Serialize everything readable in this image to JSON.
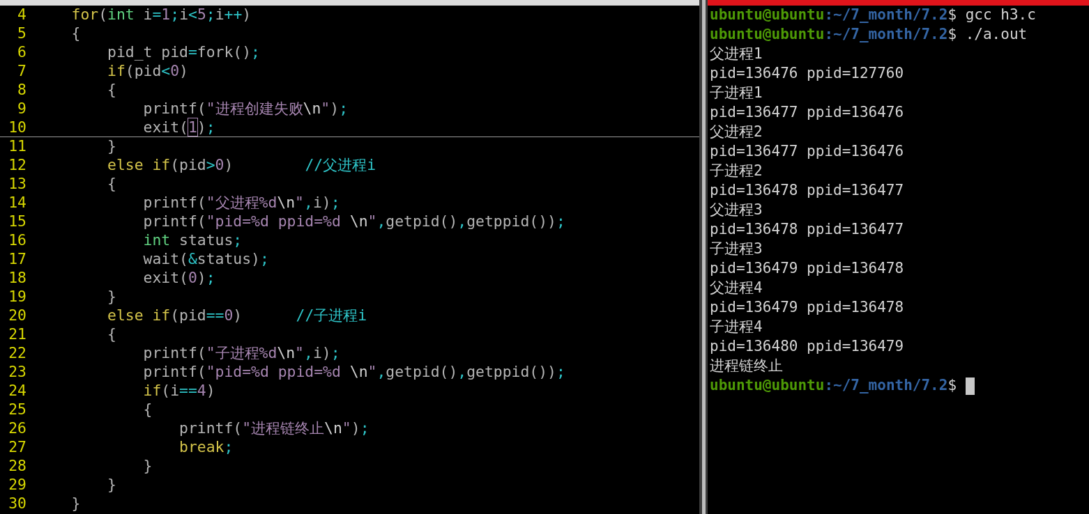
{
  "editor": {
    "lines": [
      {
        "number": "4",
        "tokens": [
          {
            "t": "    for",
            "kind": "kw"
          },
          {
            "t": "(",
            "kind": "plain"
          },
          {
            "t": "int",
            "kind": "type"
          },
          {
            "t": " i",
            "kind": "plain"
          },
          {
            "t": "=",
            "kind": "op"
          },
          {
            "t": "1",
            "kind": "num"
          },
          {
            "t": ";",
            "kind": "op"
          },
          {
            "t": "i",
            "kind": "plain"
          },
          {
            "t": "<",
            "kind": "op"
          },
          {
            "t": "5",
            "kind": "num"
          },
          {
            "t": ";",
            "kind": "op"
          },
          {
            "t": "i",
            "kind": "plain"
          },
          {
            "t": "++",
            "kind": "op"
          },
          {
            "t": ")",
            "kind": "plain"
          }
        ]
      },
      {
        "number": "5",
        "tokens": [
          {
            "t": "    {",
            "kind": "plain"
          }
        ]
      },
      {
        "number": "6",
        "tokens": [
          {
            "t": "        pid_t pid",
            "kind": "plain"
          },
          {
            "t": "=",
            "kind": "op"
          },
          {
            "t": "fork()",
            "kind": "plain"
          },
          {
            "t": ";",
            "kind": "op"
          }
        ]
      },
      {
        "number": "7",
        "tokens": [
          {
            "t": "        if",
            "kind": "kw"
          },
          {
            "t": "(pid",
            "kind": "plain"
          },
          {
            "t": "<",
            "kind": "op"
          },
          {
            "t": "0",
            "kind": "num"
          },
          {
            "t": ")",
            "kind": "plain"
          }
        ]
      },
      {
        "number": "8",
        "tokens": [
          {
            "t": "        {",
            "kind": "plain"
          }
        ]
      },
      {
        "number": "9",
        "tokens": [
          {
            "t": "            printf(",
            "kind": "plain"
          },
          {
            "t": "\"进程创建失败",
            "kind": "str"
          },
          {
            "t": "\\n",
            "kind": "esc"
          },
          {
            "t": "\"",
            "kind": "str"
          },
          {
            "t": ")",
            "kind": "plain"
          },
          {
            "t": ";",
            "kind": "op"
          }
        ]
      },
      {
        "number": "10",
        "current": true,
        "tokens": [
          {
            "t": "            exit(",
            "kind": "plain"
          },
          {
            "t": "1",
            "kind": "num",
            "cursor": true
          },
          {
            "t": ")",
            "kind": "plain"
          },
          {
            "t": ";",
            "kind": "op"
          }
        ]
      },
      {
        "number": "11",
        "tokens": [
          {
            "t": "        }",
            "kind": "plain"
          }
        ]
      },
      {
        "number": "12",
        "tokens": [
          {
            "t": "        else if",
            "kind": "kw"
          },
          {
            "t": "(pid",
            "kind": "plain"
          },
          {
            "t": ">",
            "kind": "op"
          },
          {
            "t": "0",
            "kind": "num"
          },
          {
            "t": ")        ",
            "kind": "plain"
          },
          {
            "t": "//父进程i",
            "kind": "cmt"
          }
        ]
      },
      {
        "number": "13",
        "tokens": [
          {
            "t": "        {",
            "kind": "plain"
          }
        ]
      },
      {
        "number": "14",
        "tokens": [
          {
            "t": "            printf(",
            "kind": "plain"
          },
          {
            "t": "\"父进程%d",
            "kind": "str"
          },
          {
            "t": "\\n",
            "kind": "esc"
          },
          {
            "t": "\"",
            "kind": "str"
          },
          {
            "t": ",",
            "kind": "op"
          },
          {
            "t": "i)",
            "kind": "plain"
          },
          {
            "t": ";",
            "kind": "op"
          }
        ]
      },
      {
        "number": "15",
        "tokens": [
          {
            "t": "            printf(",
            "kind": "plain"
          },
          {
            "t": "\"pid=%d ppid=%d ",
            "kind": "str"
          },
          {
            "t": "\\n",
            "kind": "esc"
          },
          {
            "t": "\"",
            "kind": "str"
          },
          {
            "t": ",",
            "kind": "op"
          },
          {
            "t": "getpid()",
            "kind": "plain"
          },
          {
            "t": ",",
            "kind": "op"
          },
          {
            "t": "getppid())",
            "kind": "plain"
          },
          {
            "t": ";",
            "kind": "op"
          }
        ]
      },
      {
        "number": "16",
        "tokens": [
          {
            "t": "            int",
            "kind": "type"
          },
          {
            "t": " status",
            "kind": "plain"
          },
          {
            "t": ";",
            "kind": "op"
          }
        ]
      },
      {
        "number": "17",
        "tokens": [
          {
            "t": "            wait(",
            "kind": "plain"
          },
          {
            "t": "&",
            "kind": "op"
          },
          {
            "t": "status)",
            "kind": "plain"
          },
          {
            "t": ";",
            "kind": "op"
          }
        ]
      },
      {
        "number": "18",
        "tokens": [
          {
            "t": "            exit(",
            "kind": "plain"
          },
          {
            "t": "0",
            "kind": "num"
          },
          {
            "t": ")",
            "kind": "plain"
          },
          {
            "t": ";",
            "kind": "op"
          }
        ]
      },
      {
        "number": "19",
        "tokens": [
          {
            "t": "        }",
            "kind": "plain"
          }
        ]
      },
      {
        "number": "20",
        "tokens": [
          {
            "t": "        else if",
            "kind": "kw"
          },
          {
            "t": "(pid",
            "kind": "plain"
          },
          {
            "t": "==",
            "kind": "op"
          },
          {
            "t": "0",
            "kind": "num"
          },
          {
            "t": ")      ",
            "kind": "plain"
          },
          {
            "t": "//子进程i",
            "kind": "cmt"
          }
        ]
      },
      {
        "number": "21",
        "tokens": [
          {
            "t": "        {",
            "kind": "plain"
          }
        ]
      },
      {
        "number": "22",
        "tokens": [
          {
            "t": "            printf(",
            "kind": "plain"
          },
          {
            "t": "\"子进程%d",
            "kind": "str"
          },
          {
            "t": "\\n",
            "kind": "esc"
          },
          {
            "t": "\"",
            "kind": "str"
          },
          {
            "t": ",",
            "kind": "op"
          },
          {
            "t": "i)",
            "kind": "plain"
          },
          {
            "t": ";",
            "kind": "op"
          }
        ]
      },
      {
        "number": "23",
        "tokens": [
          {
            "t": "            printf(",
            "kind": "plain"
          },
          {
            "t": "\"pid=%d ppid=%d ",
            "kind": "str"
          },
          {
            "t": "\\n",
            "kind": "esc"
          },
          {
            "t": "\"",
            "kind": "str"
          },
          {
            "t": ",",
            "kind": "op"
          },
          {
            "t": "getpid()",
            "kind": "plain"
          },
          {
            "t": ",",
            "kind": "op"
          },
          {
            "t": "getppid())",
            "kind": "plain"
          },
          {
            "t": ";",
            "kind": "op"
          }
        ]
      },
      {
        "number": "24",
        "tokens": [
          {
            "t": "            if",
            "kind": "kw"
          },
          {
            "t": "(i",
            "kind": "plain"
          },
          {
            "t": "==",
            "kind": "op"
          },
          {
            "t": "4",
            "kind": "num"
          },
          {
            "t": ")",
            "kind": "plain"
          }
        ]
      },
      {
        "number": "25",
        "tokens": [
          {
            "t": "            {",
            "kind": "plain"
          }
        ]
      },
      {
        "number": "26",
        "tokens": [
          {
            "t": "                printf(",
            "kind": "plain"
          },
          {
            "t": "\"进程链终止",
            "kind": "str"
          },
          {
            "t": "\\n",
            "kind": "esc"
          },
          {
            "t": "\"",
            "kind": "str"
          },
          {
            "t": ")",
            "kind": "plain"
          },
          {
            "t": ";",
            "kind": "op"
          }
        ]
      },
      {
        "number": "27",
        "tokens": [
          {
            "t": "                break",
            "kind": "kw"
          },
          {
            "t": ";",
            "kind": "op"
          }
        ]
      },
      {
        "number": "28",
        "tokens": [
          {
            "t": "            }",
            "kind": "plain"
          }
        ]
      },
      {
        "number": "29",
        "tokens": [
          {
            "t": "        }",
            "kind": "plain"
          }
        ]
      },
      {
        "number": "30",
        "tokens": [
          {
            "t": "    }",
            "kind": "plain"
          }
        ]
      }
    ]
  },
  "terminal": {
    "lines": [
      {
        "kind": "prompt",
        "user": "ubuntu@ubuntu",
        "path": ":~/7_month/7.2",
        "command": "$ gcc h3.c"
      },
      {
        "kind": "prompt",
        "user": "ubuntu@ubuntu",
        "path": ":~/7_month/7.2",
        "command": "$ ./a.out"
      },
      {
        "kind": "output",
        "text": "父进程1"
      },
      {
        "kind": "output",
        "text": "pid=136476 ppid=127760"
      },
      {
        "kind": "output",
        "text": "子进程1"
      },
      {
        "kind": "output",
        "text": "pid=136477 ppid=136476"
      },
      {
        "kind": "output",
        "text": "父进程2"
      },
      {
        "kind": "output",
        "text": "pid=136477 ppid=136476"
      },
      {
        "kind": "output",
        "text": "子进程2"
      },
      {
        "kind": "output",
        "text": "pid=136478 ppid=136477"
      },
      {
        "kind": "output",
        "text": "父进程3"
      },
      {
        "kind": "output",
        "text": "pid=136478 ppid=136477"
      },
      {
        "kind": "output",
        "text": "子进程3"
      },
      {
        "kind": "output",
        "text": "pid=136479 ppid=136478"
      },
      {
        "kind": "output",
        "text": "父进程4"
      },
      {
        "kind": "output",
        "text": "pid=136479 ppid=136478"
      },
      {
        "kind": "output",
        "text": "子进程4"
      },
      {
        "kind": "output",
        "text": "pid=136480 ppid=136479"
      },
      {
        "kind": "output",
        "text": "进程链终止"
      },
      {
        "kind": "prompt",
        "user": "ubuntu@ubuntu",
        "path": ":~/7_month/7.2",
        "command": "$",
        "cursor": true
      }
    ]
  }
}
